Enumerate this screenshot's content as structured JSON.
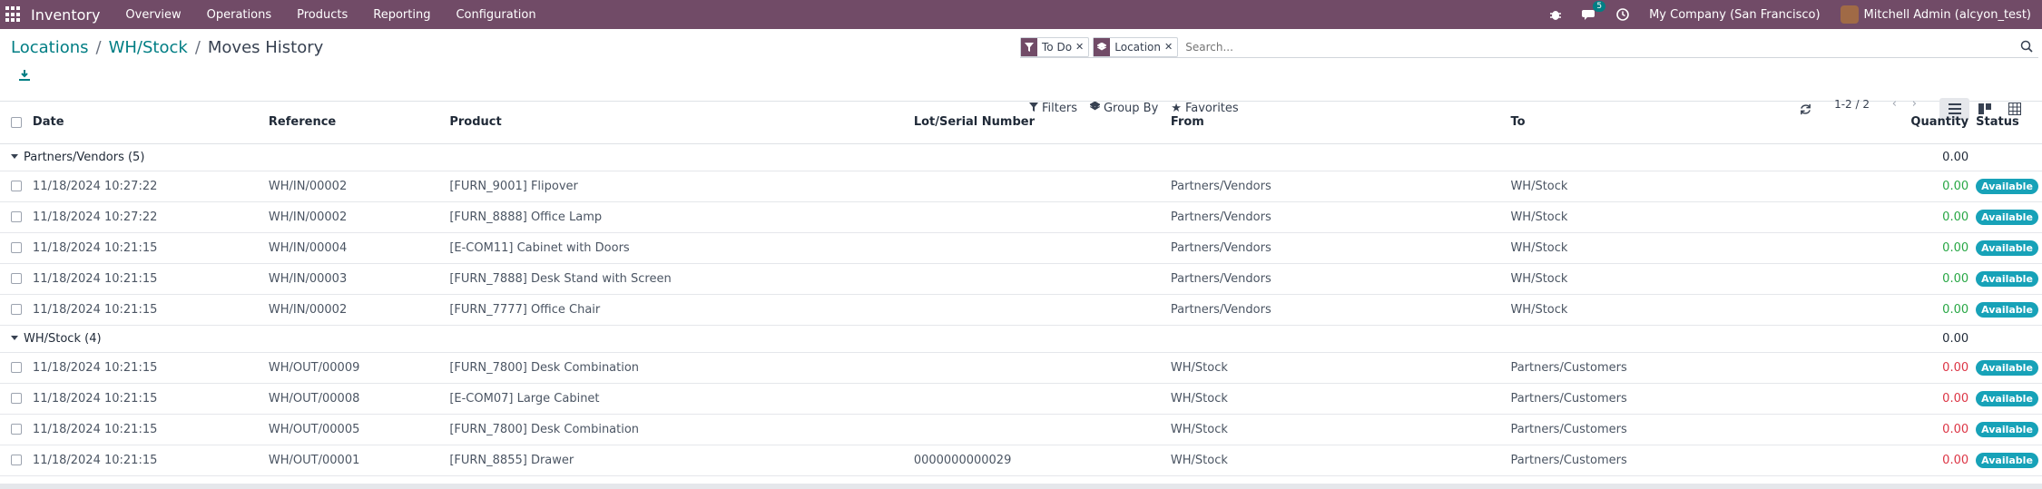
{
  "topbar": {
    "app_name": "Inventory",
    "menu": [
      "Overview",
      "Operations",
      "Products",
      "Reporting",
      "Configuration"
    ],
    "chat_count": "5",
    "company": "My Company (San Francisco)",
    "user": "Mitchell Admin (alcyon_test)"
  },
  "breadcrumb": {
    "items": [
      "Locations",
      "WH/Stock"
    ],
    "current": "Moves History",
    "sep": "/"
  },
  "search": {
    "facets": [
      {
        "label": "To Do",
        "icon": "filter-icon"
      },
      {
        "label": "Location",
        "icon": "layers-icon"
      }
    ],
    "placeholder": "Search..."
  },
  "filters": {
    "filters_label": "Filters",
    "group_label": "Group By",
    "favorites_label": "Favorites"
  },
  "pager": {
    "value": "1-2 / 2"
  },
  "table": {
    "headers": {
      "date": "Date",
      "reference": "Reference",
      "product": "Product",
      "lot": "Lot/Serial Number",
      "from": "From",
      "to": "To",
      "quantity": "Quantity",
      "status": "Status"
    },
    "groups": [
      {
        "label": "Partners/Vendors (5)",
        "total": "0.00",
        "rows": [
          {
            "date": "11/18/2024 10:27:22",
            "reference": "WH/IN/00002",
            "product": "[FURN_9001] Flipover",
            "lot": "",
            "from": "Partners/Vendors",
            "to": "WH/Stock",
            "quantity": "0.00",
            "status": "Available"
          },
          {
            "date": "11/18/2024 10:27:22",
            "reference": "WH/IN/00002",
            "product": "[FURN_8888] Office Lamp",
            "lot": "",
            "from": "Partners/Vendors",
            "to": "WH/Stock",
            "quantity": "0.00",
            "status": "Available"
          },
          {
            "date": "11/18/2024 10:21:15",
            "reference": "WH/IN/00004",
            "product": "[E-COM11] Cabinet with Doors",
            "lot": "",
            "from": "Partners/Vendors",
            "to": "WH/Stock",
            "quantity": "0.00",
            "status": "Available"
          },
          {
            "date": "11/18/2024 10:21:15",
            "reference": "WH/IN/00003",
            "product": "[FURN_7888] Desk Stand with Screen",
            "lot": "",
            "from": "Partners/Vendors",
            "to": "WH/Stock",
            "quantity": "0.00",
            "status": "Available"
          },
          {
            "date": "11/18/2024 10:21:15",
            "reference": "WH/IN/00002",
            "product": "[FURN_7777] Office Chair",
            "lot": "",
            "from": "Partners/Vendors",
            "to": "WH/Stock",
            "quantity": "0.00",
            "status": "Available"
          }
        ]
      },
      {
        "label": "WH/Stock (4)",
        "total": "0.00",
        "rows": [
          {
            "date": "11/18/2024 10:21:15",
            "reference": "WH/OUT/00009",
            "product": "[FURN_7800] Desk Combination",
            "lot": "",
            "from": "WH/Stock",
            "to": "Partners/Customers",
            "quantity": "0.00",
            "status": "Available"
          },
          {
            "date": "11/18/2024 10:21:15",
            "reference": "WH/OUT/00008",
            "product": "[E-COM07] Large Cabinet",
            "lot": "",
            "from": "WH/Stock",
            "to": "Partners/Customers",
            "quantity": "0.00",
            "status": "Available"
          },
          {
            "date": "11/18/2024 10:21:15",
            "reference": "WH/OUT/00005",
            "product": "[FURN_7800] Desk Combination",
            "lot": "",
            "from": "WH/Stock",
            "to": "Partners/Customers",
            "quantity": "0.00",
            "status": "Available"
          },
          {
            "date": "11/18/2024 10:21:15",
            "reference": "WH/OUT/00001",
            "product": "[FURN_8855] Drawer",
            "lot": "0000000000029",
            "from": "WH/Stock",
            "to": "Partners/Customers",
            "quantity": "0.00",
            "status": "Available"
          }
        ]
      }
    ]
  },
  "colors": {
    "brand": "#714B67",
    "link": "#017e84",
    "qty_in": "#28a745",
    "qty_out": "#dc3545",
    "badge": "#17a2b8"
  }
}
